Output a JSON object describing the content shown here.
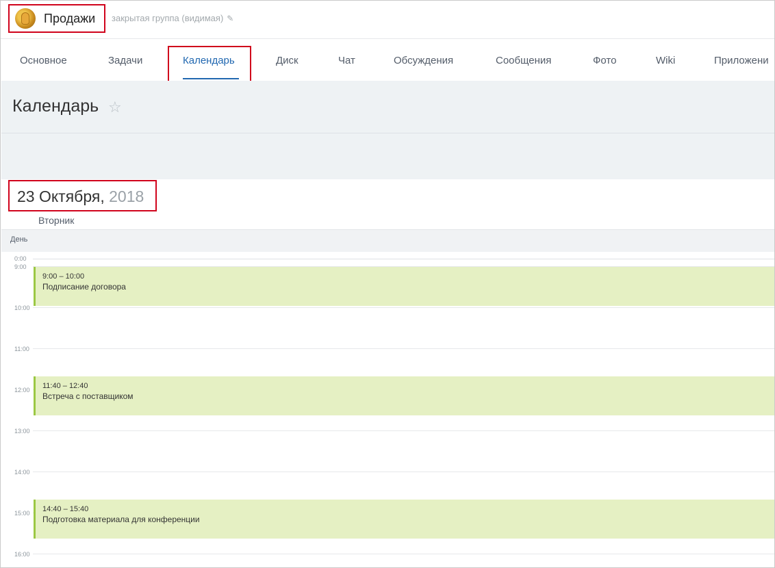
{
  "group": {
    "name": "Продажи",
    "privacy": "закрытая группа (видимая)"
  },
  "tabs": [
    {
      "label": "Основное"
    },
    {
      "label": "Задачи"
    },
    {
      "label": "Календарь"
    },
    {
      "label": "Диск"
    },
    {
      "label": "Чат"
    },
    {
      "label": "Обсуждения"
    },
    {
      "label": "Сообщения"
    },
    {
      "label": "Фото"
    },
    {
      "label": "Wiki"
    },
    {
      "label": "Приложени"
    }
  ],
  "page": {
    "title": "Календарь",
    "star": "☆"
  },
  "date": {
    "day_month": "23 Октября,",
    "year": "2018",
    "weekday": "Вторник"
  },
  "view": {
    "day_label": "День"
  },
  "hours": [
    "0:00",
    "9:00",
    "10:00",
    "11:00",
    "12:00",
    "13:00",
    "14:00",
    "15:00",
    "16:00"
  ],
  "events": [
    {
      "time": "9:00 – 10:00",
      "title": "Подписание договора"
    },
    {
      "time": "11:40 – 12:40",
      "title": "Встреча с поставщиком"
    },
    {
      "time": "14:40 – 15:40",
      "title": "Подготовка материала для конференции"
    }
  ],
  "colors": {
    "accent": "#2067b0",
    "highlight": "#d0021b",
    "event_bg": "#e5f0c3",
    "event_border": "#9bc843"
  }
}
